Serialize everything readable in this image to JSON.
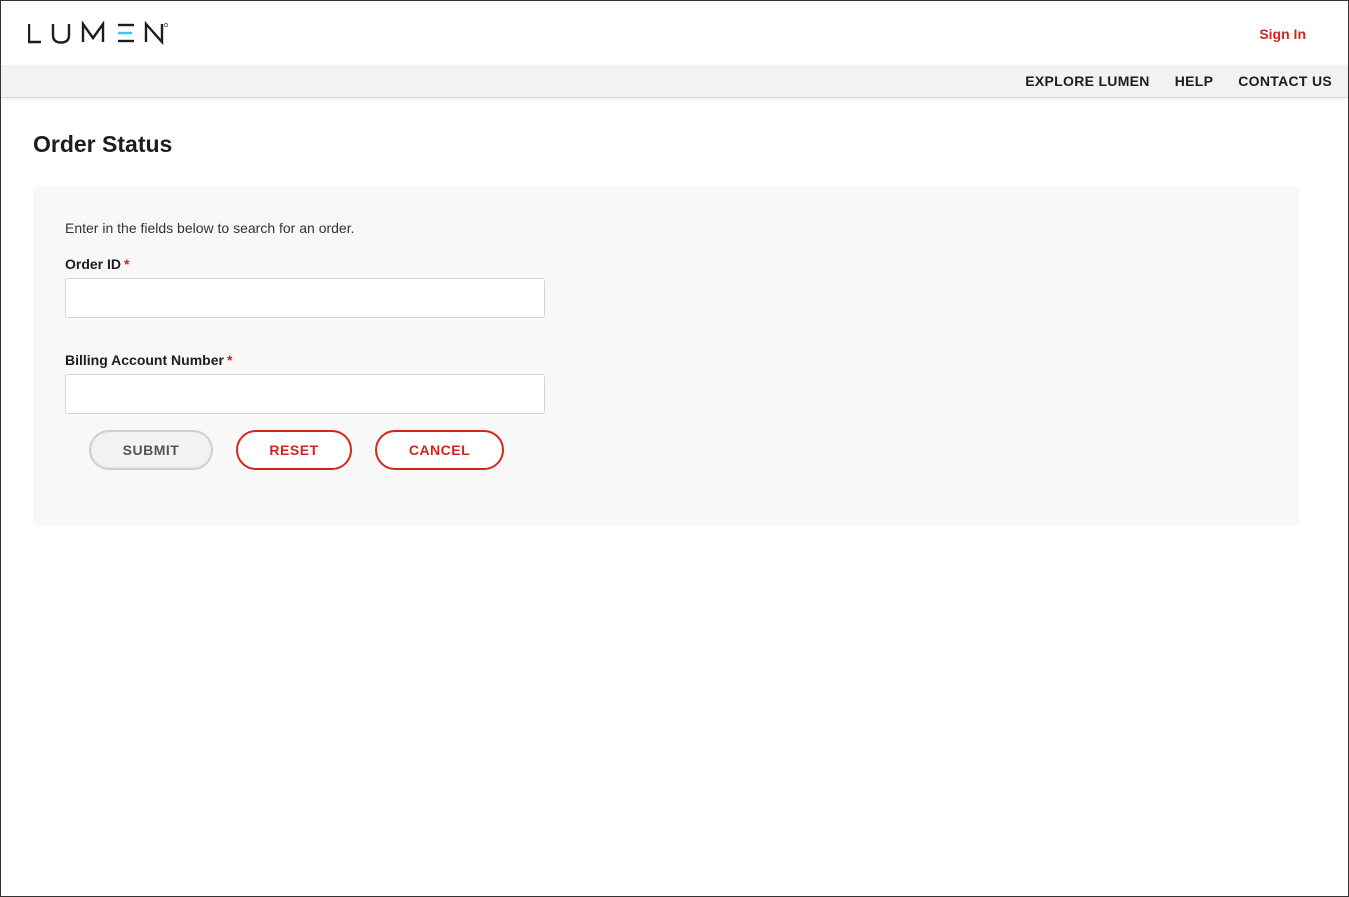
{
  "header": {
    "logo_text": "LUMEN",
    "logo_mark": "®",
    "signin_label": "Sign In"
  },
  "nav": {
    "items": [
      {
        "label": "EXPLORE LUMEN"
      },
      {
        "label": "HELP"
      },
      {
        "label": "CONTACT US"
      }
    ]
  },
  "page": {
    "title": "Order Status"
  },
  "form": {
    "intro": "Enter in the fields below to search for an order.",
    "required_mark": "*",
    "order_id": {
      "label": "Order ID",
      "value": "",
      "placeholder": ""
    },
    "billing_account": {
      "label": "Billing Account Number",
      "value": "",
      "placeholder": ""
    },
    "buttons": {
      "submit": "SUBMIT",
      "reset": "RESET",
      "cancel": "CANCEL"
    }
  },
  "colors": {
    "accent": "#d0271d",
    "logo_accent": "#38c6f4",
    "text": "#1d1d1d",
    "panel_bg": "#f8f8f8",
    "navbar_bg": "#f3f2f2"
  }
}
